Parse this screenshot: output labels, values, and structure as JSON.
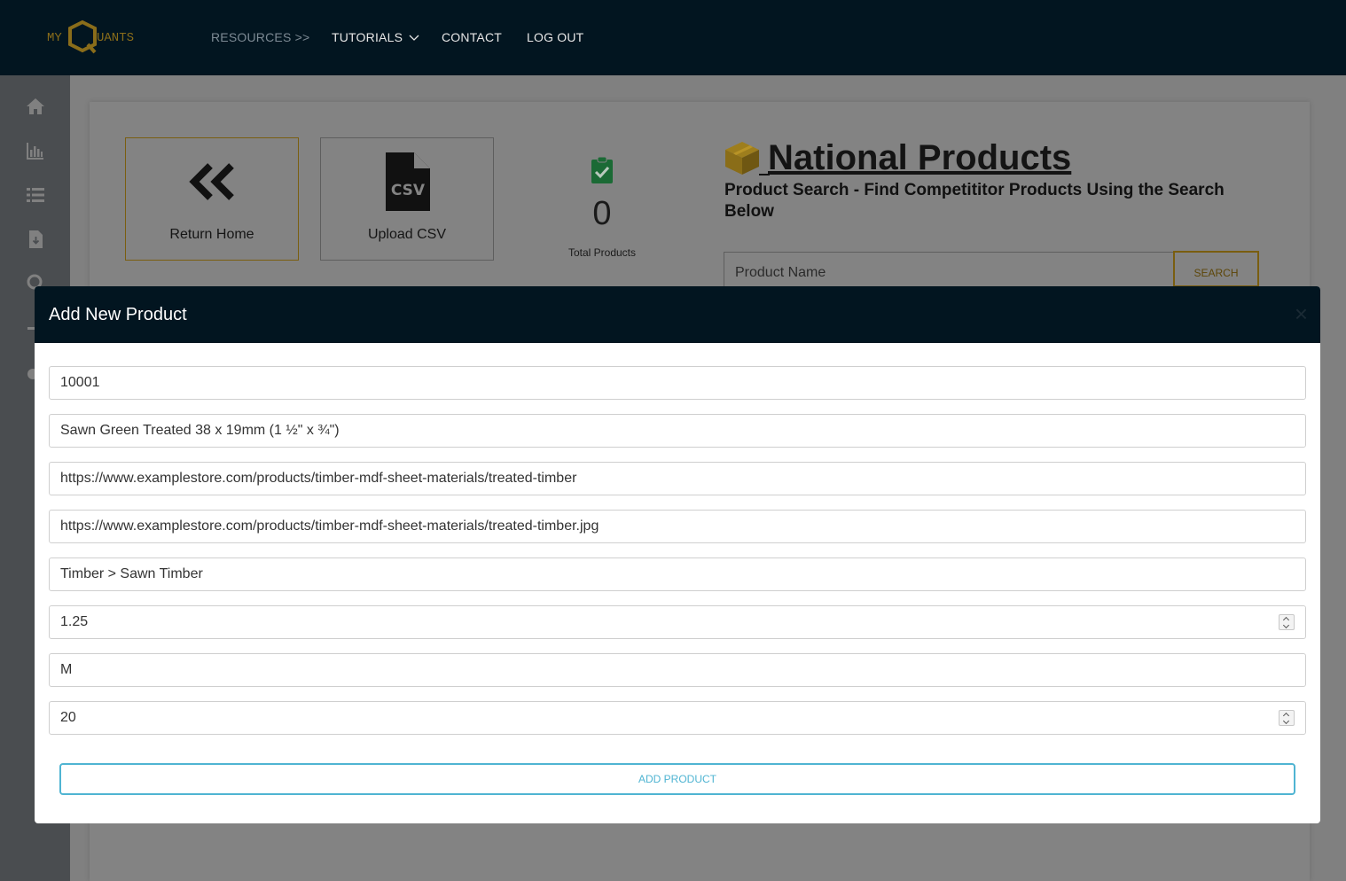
{
  "brand": {
    "logo_left": "MY",
    "logo_right": "UANTS"
  },
  "nav": {
    "resources": "RESOURCES >>",
    "tutorials": "TUTORIALS",
    "contact": "CONTACT",
    "logout": "LOG OUT"
  },
  "sidebar": {
    "icons": [
      "home-icon",
      "bar-chart-icon",
      "list-icon",
      "download-file-icon",
      "location-icon",
      "tool-icon",
      "gear-icon"
    ]
  },
  "dashboard": {
    "return_home": "Return Home",
    "upload_csv": "Upload CSV",
    "total_count": "0",
    "total_label": "Total Products",
    "title": "National Products",
    "subtitle": "Product Search - Find Competititor Products Using the Search Below",
    "search_placeholder": "Product Name",
    "search_button": "SEARCH"
  },
  "modal": {
    "title": "Add New Product",
    "close": "×",
    "fields": [
      "10001",
      "Sawn Green Treated 38 x 19mm (1 ½\" x ¾\")",
      "https://www.examplestore.com/products/timber-mdf-sheet-materials/treated-timber",
      "https://www.examplestore.com/products/timber-mdf-sheet-materials/treated-timber.jpg",
      "Timber > Sawn Timber",
      "1.25",
      "M",
      "20"
    ],
    "submit": "ADD PRODUCT"
  },
  "colors": {
    "navy": "#021520",
    "gold": "#c9a227",
    "accent": "#4fb4d2",
    "green": "#1b8a3a"
  }
}
